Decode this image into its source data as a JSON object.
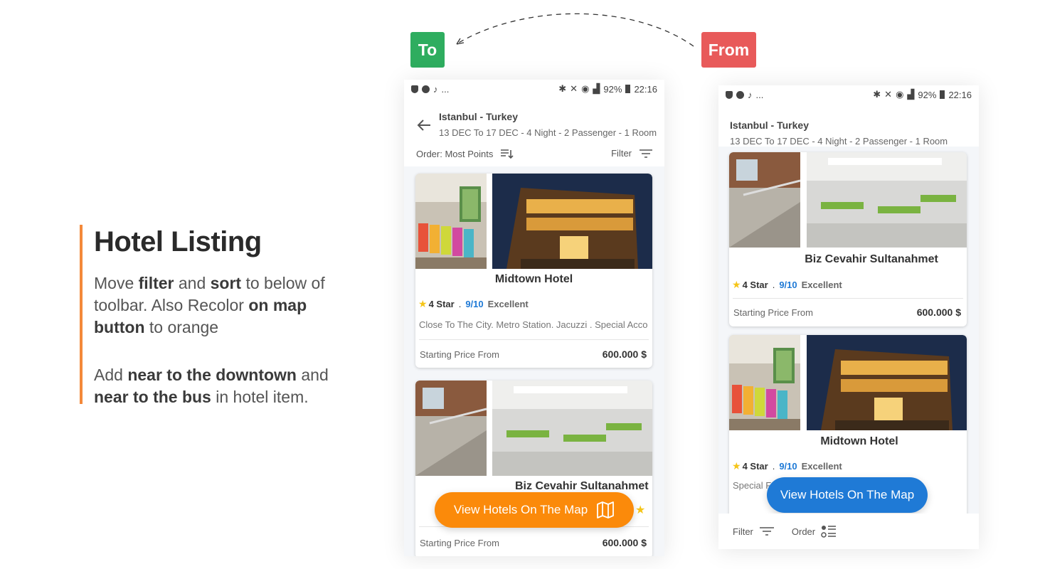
{
  "description": {
    "title": "Hotel Listing",
    "p1": [
      {
        "t": "Move ",
        "b": false
      },
      {
        "t": "filter",
        "b": true
      },
      {
        "t": " and ",
        "b": false
      },
      {
        "t": "sort",
        "b": true
      },
      {
        "t": " to below of toolbar. Also Recolor ",
        "b": false
      },
      {
        "t": "on map button",
        "b": true
      },
      {
        "t": " to orange",
        "b": false
      }
    ],
    "p2": [
      {
        "t": "Add ",
        "b": false
      },
      {
        "t": "near to the downtown",
        "b": true
      },
      {
        "t": " and ",
        "b": false
      },
      {
        "t": "near to the bus",
        "b": true
      },
      {
        "t": " in hotel item.",
        "b": false
      }
    ]
  },
  "tags": {
    "to": "To",
    "from": "From"
  },
  "status": {
    "dots": "...",
    "battery": "92%",
    "time": "22:16"
  },
  "header": {
    "city": "Istanbul - Turkey",
    "details": "13 DEC  To 17 DEC - 4 Night - 2 Passenger - 1 Room"
  },
  "toolbar": {
    "order": "Order: Most Points",
    "filter": "Filter"
  },
  "hotels": {
    "midtown": {
      "name": "Midtown Hotel",
      "stars": "4 Star",
      "sep": ".",
      "score": "9/10",
      "label": "Excellent",
      "features": "Close To The City. Metro Station. Jacuzzi . Special Acco",
      "features_short": "Special F",
      "price_label": "Starting Price From",
      "price": "600.000 $"
    },
    "biz": {
      "name": "Biz Cevahir Sultanahmet",
      "stars": "4 Star",
      "sep": ".",
      "score": "9/10",
      "label": "Excellent",
      "price_label": "Starting Price From",
      "price": "600.000 $"
    }
  },
  "map_button": {
    "label": "View Hotels On The Map"
  },
  "bottom_bar": {
    "filter": "Filter",
    "order": "Order"
  },
  "colors": {
    "orange": "#fb8a0a",
    "blue": "#1f7ad6",
    "to": "#2ead5f",
    "from": "#e85a5a",
    "accent": "#f4893a"
  }
}
